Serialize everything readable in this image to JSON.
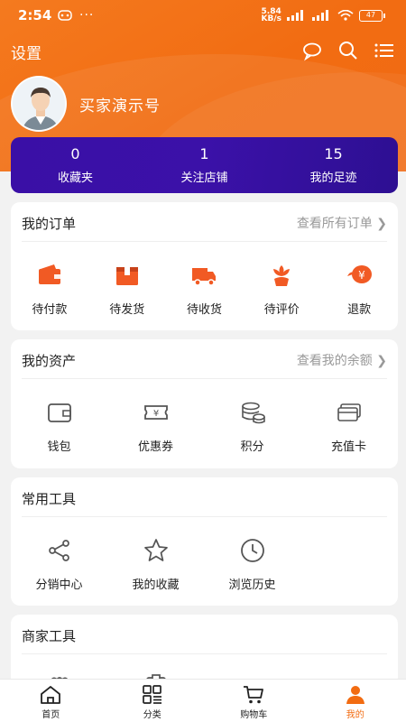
{
  "status": {
    "time": "2:54",
    "net_speed": "5.84\nKB/s",
    "battery": "47"
  },
  "header": {
    "settings_label": "设置",
    "username": "买家演示号"
  },
  "stats": [
    {
      "value": "0",
      "label": "收藏夹"
    },
    {
      "value": "1",
      "label": "关注店铺"
    },
    {
      "value": "15",
      "label": "我的足迹"
    }
  ],
  "orders": {
    "title": "我的订单",
    "link": "查看所有订单",
    "items": [
      {
        "label": "待付款",
        "icon": "wallet-icon"
      },
      {
        "label": "待发货",
        "icon": "package-icon"
      },
      {
        "label": "待收货",
        "icon": "truck-icon"
      },
      {
        "label": "待评价",
        "icon": "flower-icon"
      },
      {
        "label": "退款",
        "icon": "refund-icon"
      }
    ]
  },
  "assets": {
    "title": "我的资产",
    "link": "查看我的余额",
    "items": [
      {
        "label": "钱包",
        "icon": "wallet-outline-icon"
      },
      {
        "label": "优惠券",
        "icon": "coupon-icon"
      },
      {
        "label": "积分",
        "icon": "coins-icon"
      },
      {
        "label": "充值卡",
        "icon": "card-icon"
      }
    ]
  },
  "tools": {
    "title": "常用工具",
    "items": [
      {
        "label": "分销中心",
        "icon": "share-icon"
      },
      {
        "label": "我的收藏",
        "icon": "star-icon"
      },
      {
        "label": "浏览历史",
        "icon": "clock-icon"
      }
    ]
  },
  "merchant": {
    "title": "商家工具"
  },
  "tabbar": [
    {
      "label": "首页",
      "icon": "home-icon"
    },
    {
      "label": "分类",
      "icon": "category-icon"
    },
    {
      "label": "购物车",
      "icon": "cart-icon"
    },
    {
      "label": "我的",
      "icon": "user-icon"
    }
  ],
  "colors": {
    "accent": "#f26c12",
    "stats_bg": "#3b11a8"
  }
}
